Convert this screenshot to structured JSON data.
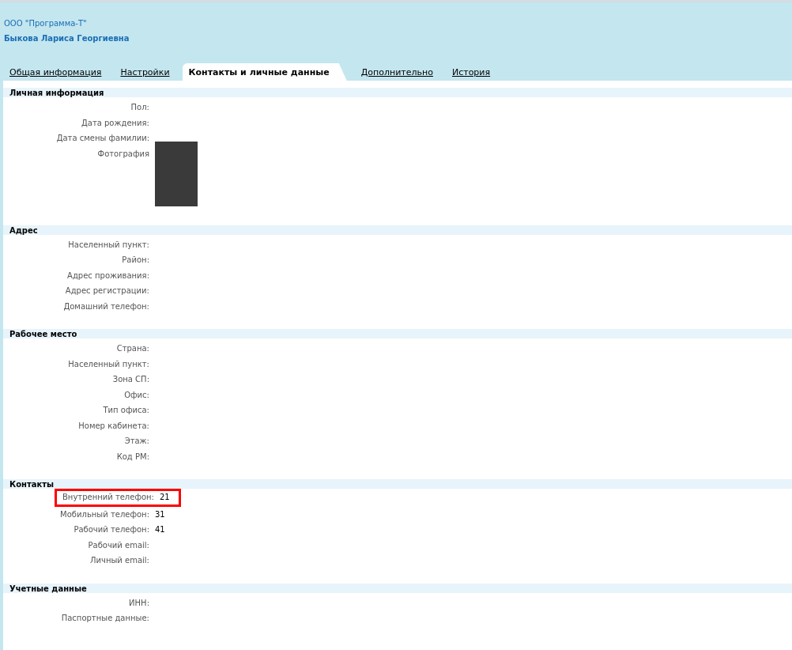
{
  "header": {
    "company": "ООО \"Программа-Т\"",
    "person": "Быкова Лариса Георгиевна"
  },
  "tabs": [
    {
      "label": "Общая информация",
      "selected": false
    },
    {
      "label": "Настройки",
      "selected": false
    },
    {
      "label": "Контакты и личные данные",
      "selected": true
    },
    {
      "label": "Дополнительно",
      "selected": false
    },
    {
      "label": "История",
      "selected": false
    }
  ],
  "sections": [
    {
      "title": "Личная информация",
      "fields": [
        {
          "kind": "text",
          "label": "Пол:",
          "highlighted": false
        },
        {
          "kind": "text",
          "label": "Дата рождения:",
          "highlighted": false
        },
        {
          "kind": "text",
          "label": "Дата смены фамилии:",
          "highlighted": false
        },
        {
          "kind": "photo",
          "label": "Фотография",
          "highlighted": false
        }
      ]
    },
    {
      "title": "Адрес",
      "fields": [
        {
          "kind": "text",
          "label": "Населенный пункт:",
          "highlighted": false
        },
        {
          "kind": "text",
          "label": "Район:",
          "highlighted": false
        },
        {
          "kind": "text",
          "label": "Адрес проживания:",
          "highlighted": false
        },
        {
          "kind": "text",
          "label": "Адрес регистрации:",
          "highlighted": false
        },
        {
          "kind": "text",
          "label": "Домашний телефон:",
          "highlighted": false
        }
      ]
    },
    {
      "title": "Рабочее место",
      "fields": [
        {
          "kind": "text",
          "label": "Страна:",
          "highlighted": false
        },
        {
          "kind": "text",
          "label": "Населенный пункт:",
          "highlighted": false
        },
        {
          "kind": "text",
          "label": "Зона СП:",
          "highlighted": false
        },
        {
          "kind": "text",
          "label": "Офис:",
          "highlighted": false
        },
        {
          "kind": "text",
          "label": "Тип офиса:",
          "highlighted": false
        },
        {
          "kind": "text",
          "label": "Номер кабинета:",
          "highlighted": false
        },
        {
          "kind": "text",
          "label": "Этаж:",
          "highlighted": false
        },
        {
          "kind": "text",
          "label": "Код РМ:",
          "highlighted": false
        }
      ]
    },
    {
      "title": "Контакты",
      "fields": [
        {
          "kind": "text",
          "label": "Внутренний телефон:",
          "value": "21",
          "highlighted": true
        },
        {
          "kind": "text",
          "label": "Мобильный телефон:",
          "value": "31",
          "highlighted": false
        },
        {
          "kind": "text",
          "label": "Рабочий телефон:",
          "value": "41",
          "highlighted": false
        },
        {
          "kind": "text",
          "label": "Рабочий email:",
          "highlighted": false
        },
        {
          "kind": "text",
          "label": "Личный email:",
          "highlighted": false
        }
      ]
    },
    {
      "title": "Учетные данные",
      "fields": [
        {
          "kind": "text",
          "label": "ИНН:",
          "highlighted": false
        },
        {
          "kind": "text",
          "label": "Паспортные данные:",
          "highlighted": false
        }
      ]
    }
  ]
}
